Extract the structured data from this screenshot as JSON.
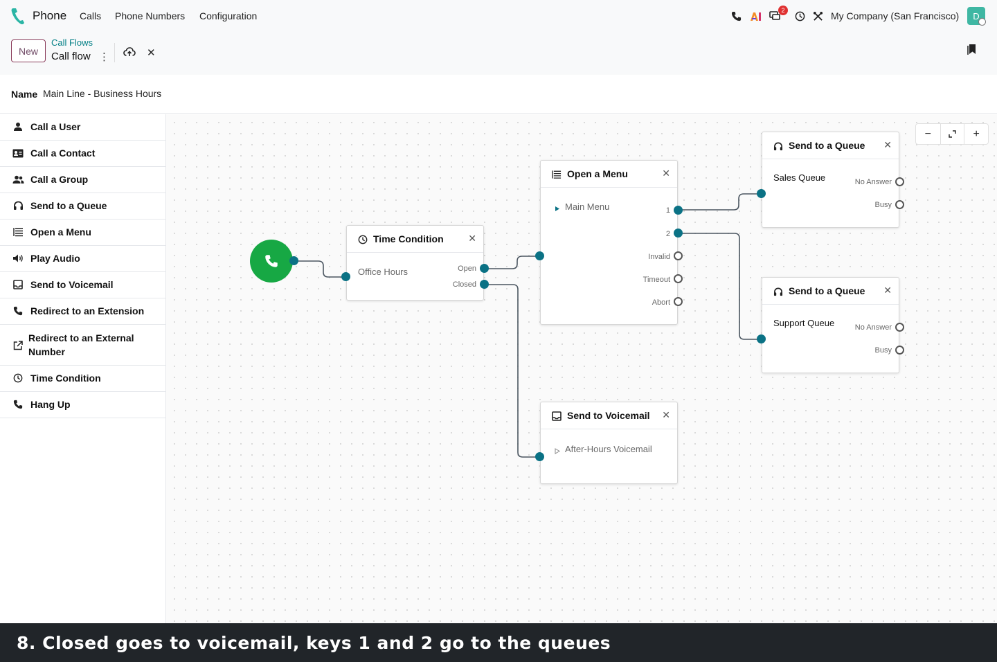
{
  "topbar": {
    "app_name": "Phone",
    "nav": [
      "Calls",
      "Phone Numbers",
      "Configuration"
    ],
    "chat_count": "2",
    "company": "My Company (San Francisco)",
    "avatar_letter": "D",
    "icons": [
      "phone-icon",
      "ai-icon",
      "chat-icon",
      "clock-icon",
      "tools-icon"
    ]
  },
  "control": {
    "new_label": "New",
    "breadcrumb_parent": "Call Flows",
    "breadcrumb_current": "Call flow",
    "gear_label": "⋮",
    "discard_label": "✕"
  },
  "form": {
    "name_label": "Name",
    "name_value": "Main Line - Business Hours"
  },
  "sidebar": {
    "items": [
      {
        "label": "Call a User",
        "icon": "user-icon"
      },
      {
        "label": "Call a Contact",
        "icon": "contact-card-icon"
      },
      {
        "label": "Call a Group",
        "icon": "group-icon"
      },
      {
        "label": "Send to a Queue",
        "icon": "headset-icon"
      },
      {
        "label": "Open a Menu",
        "icon": "menu-list-icon"
      },
      {
        "label": "Play Audio",
        "icon": "speaker-icon"
      },
      {
        "label": "Send to Voicemail",
        "icon": "voicemail-icon"
      },
      {
        "label": "Redirect to an Extension",
        "icon": "phone-icon"
      },
      {
        "label": "Redirect to an External Number",
        "icon": "external-link-icon"
      },
      {
        "label": "Time Condition",
        "icon": "clock-icon"
      },
      {
        "label": "Hang Up",
        "icon": "phone-hangup-icon"
      }
    ]
  },
  "zoom": {
    "minus": "−",
    "plus": "+"
  },
  "nodes": {
    "time_condition": {
      "title": "Time Condition",
      "value": "Office Hours",
      "ports": [
        "Open",
        "Closed"
      ],
      "close": "✕"
    },
    "menu": {
      "title": "Open a Menu",
      "value": "Main Menu",
      "ports": [
        "1",
        "2",
        "Invalid",
        "Timeout",
        "Abort"
      ],
      "close": "✕"
    },
    "queue_sales": {
      "title": "Send to a Queue",
      "value": "Sales Queue",
      "ports": [
        "No Answer",
        "Busy"
      ],
      "close": "✕"
    },
    "queue_support": {
      "title": "Send to a Queue",
      "value": "Support Queue",
      "ports": [
        "No Answer",
        "Busy"
      ],
      "close": "✕"
    },
    "voicemail": {
      "title": "Send to Voicemail",
      "value": "After-Hours Voicemail",
      "close": "✕"
    }
  },
  "colors": {
    "accent": "#017e84",
    "port": "#0b7285",
    "start": "#17a844",
    "brand": "#714b67"
  },
  "caption": "8. Closed goes to voicemail, keys 1 and 2 go to the queues"
}
